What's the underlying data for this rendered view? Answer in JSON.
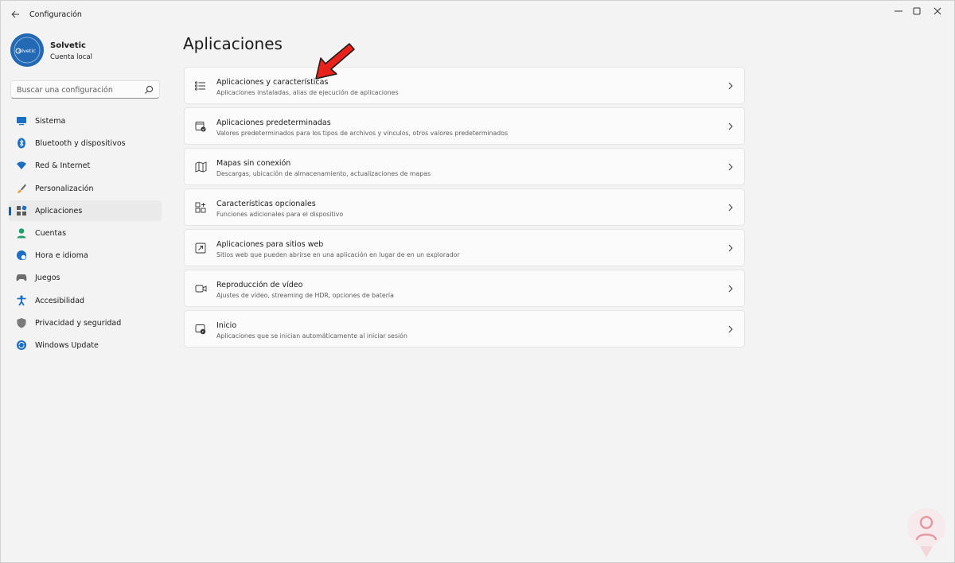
{
  "window": {
    "title": "Configuración",
    "controls": [
      "minimize-icon",
      "maximize-icon",
      "close-icon"
    ]
  },
  "profile": {
    "name": "Solvetic",
    "account_type": "Cuenta local",
    "avatar_text": "olvetic"
  },
  "search": {
    "placeholder": "Buscar una configuración"
  },
  "sidebar": {
    "items": [
      {
        "label": "Sistema",
        "icon": "system-icon"
      },
      {
        "label": "Bluetooth y dispositivos",
        "icon": "bluetooth-icon"
      },
      {
        "label": "Red & Internet",
        "icon": "wifi-icon"
      },
      {
        "label": "Personalización",
        "icon": "brush-icon"
      },
      {
        "label": "Aplicaciones",
        "icon": "apps-icon",
        "active": true
      },
      {
        "label": "Cuentas",
        "icon": "person-icon"
      },
      {
        "label": "Hora e idioma",
        "icon": "globe-clock-icon"
      },
      {
        "label": "Juegos",
        "icon": "gamepad-icon"
      },
      {
        "label": "Accesibilidad",
        "icon": "accessibility-icon"
      },
      {
        "label": "Privacidad y seguridad",
        "icon": "shield-icon"
      },
      {
        "label": "Windows Update",
        "icon": "update-icon"
      }
    ]
  },
  "main": {
    "title": "Aplicaciones",
    "cards": [
      {
        "title": "Aplicaciones y características",
        "subtitle": "Aplicaciones instaladas, alias de ejecución de aplicaciones",
        "icon": "list-icon"
      },
      {
        "title": "Aplicaciones predeterminadas",
        "subtitle": "Valores predeterminados para los tipos de archivos y vínculos, otros valores predeterminados",
        "icon": "default-apps-icon"
      },
      {
        "title": "Mapas sin conexión",
        "subtitle": "Descargas, ubicación de almacenamiento, actualizaciones de mapas",
        "icon": "map-icon"
      },
      {
        "title": "Características opcionales",
        "subtitle": "Funciones adicionales para el dispositivo",
        "icon": "grid-add-icon"
      },
      {
        "title": "Aplicaciones para sitios web",
        "subtitle": "Sitios web que pueden abrirse en una aplicación en lugar de en un explorador",
        "icon": "web-app-icon"
      },
      {
        "title": "Reproducción de vídeo",
        "subtitle": "Ajustes de vídeo, streaming de HDR, opciones de batería",
        "icon": "video-icon"
      },
      {
        "title": "Inicio",
        "subtitle": "Aplicaciones que se inician automáticamente al iniciar sesión",
        "icon": "startup-icon"
      }
    ]
  },
  "colors": {
    "accent": "#005fb8",
    "background": "#f3f3f3",
    "card": "#fbfbfb",
    "arrow": "#e8211b"
  }
}
